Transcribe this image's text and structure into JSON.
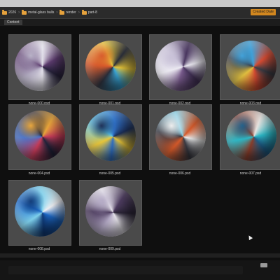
{
  "breadcrumb": [
    {
      "label": "2026",
      "icon": "folder-icon"
    },
    {
      "label": "metal-glass balls",
      "icon": "folder-icon"
    },
    {
      "label": "render",
      "icon": "folder-icon"
    },
    {
      "label": "part-8",
      "icon": "folder-icon"
    }
  ],
  "toolbar": {
    "sort_label": "Created Date"
  },
  "tabs": [
    {
      "label": "Content"
    }
  ],
  "files": [
    {
      "name": "none-000.psd",
      "colors": [
        "#e8e6ef",
        "#5c3b6e",
        "#2a2540",
        "#b7b0c6"
      ]
    },
    {
      "name": "none-001.psd",
      "colors": [
        "#2a2e3a",
        "#e7c63a",
        "#3aa7d9",
        "#d85a2b"
      ]
    },
    {
      "name": "none-002.psd",
      "colors": [
        "#eceaf2",
        "#4a3760",
        "#7a5c8e",
        "#c9c2d8"
      ]
    },
    {
      "name": "none-003.psd",
      "colors": [
        "#3a3d46",
        "#d84b32",
        "#e2c140",
        "#3fa0d8"
      ]
    },
    {
      "name": "none-004.psd",
      "colors": [
        "#20243c",
        "#c83c5a",
        "#4b74c9",
        "#e8a53a"
      ]
    },
    {
      "name": "none-005.psd",
      "colors": [
        "#2f6fc4",
        "#e7c53a",
        "#58c4e6",
        "#1b2d55"
      ]
    },
    {
      "name": "none-006.psd",
      "colors": [
        "#d65a2a",
        "#3a3b44",
        "#8ad0e6",
        "#eeeeee"
      ]
    },
    {
      "name": "none-007.psd",
      "colors": [
        "#2cb8c6",
        "#8b3d2a",
        "#e7e3e0",
        "#1f5f8a"
      ]
    },
    {
      "name": "none-008.psd",
      "colors": [
        "#1e6ac9",
        "#7fd1ec",
        "#f1f1f4",
        "#0f3a78"
      ]
    },
    {
      "name": "none-009.psd",
      "colors": [
        "#eae7ee",
        "#4c3b5e",
        "#2a2436",
        "#b4aac6"
      ]
    }
  ]
}
